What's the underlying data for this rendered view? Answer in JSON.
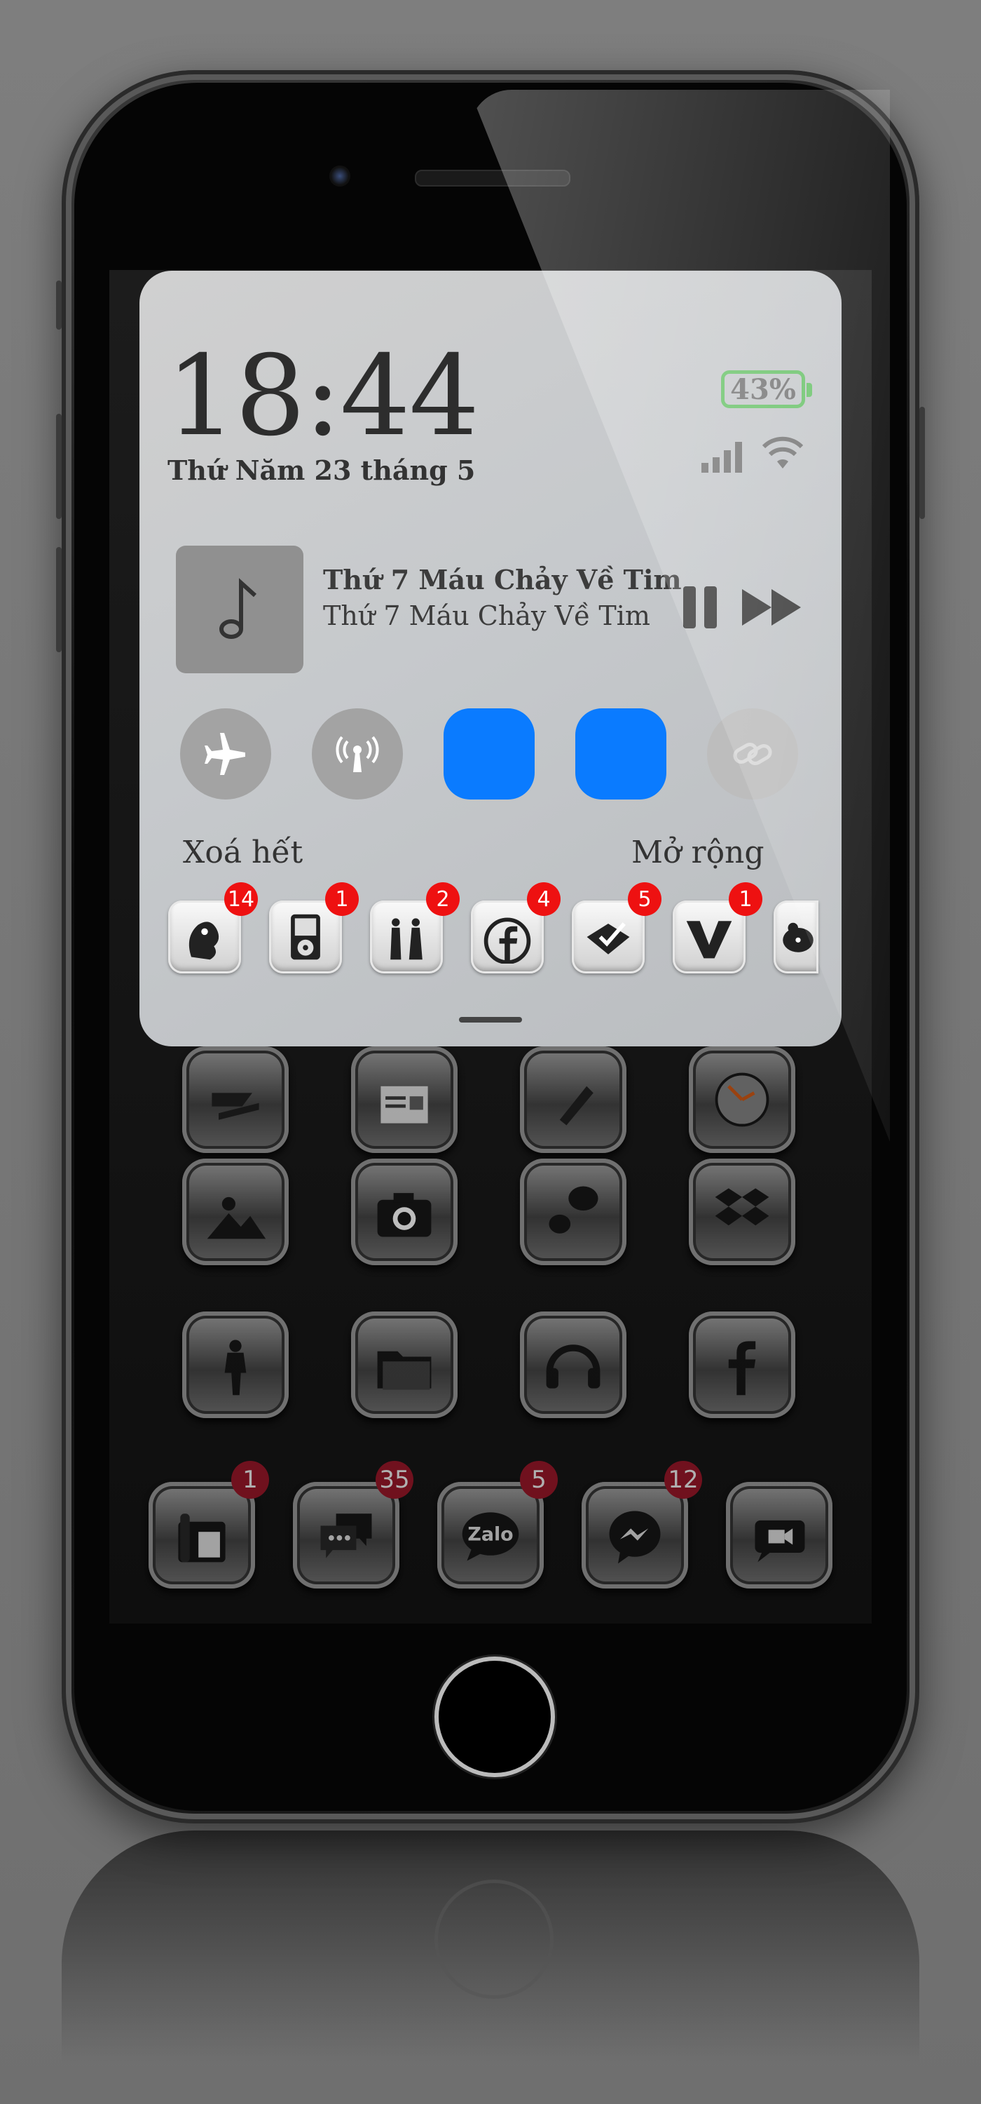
{
  "lock": {
    "time": "18:44",
    "date": "Thứ Năm 23 tháng 5",
    "battery": "43%"
  },
  "media": {
    "title": "Thứ 7 Máu Chảy Về Tim",
    "subtitle": "Thứ 7 Máu Chảy Về Tim",
    "album_icon": "music-note-icon",
    "controls": [
      "pause-icon",
      "fast-forward-icon"
    ]
  },
  "toggles": [
    {
      "name": "airplane-mode",
      "icon": "airplane-icon",
      "on": false
    },
    {
      "name": "cellular-data",
      "icon": "antenna-icon",
      "on": false
    },
    {
      "name": "toggle-3",
      "icon": "",
      "on": true
    },
    {
      "name": "toggle-4",
      "icon": "",
      "on": true
    },
    {
      "name": "screen-mirroring",
      "icon": "link-icon",
      "on": false
    }
  ],
  "notifications": {
    "clear_label": "Xoá hết",
    "expand_label": "Mở rộng",
    "apps": [
      {
        "icon": "game-icon",
        "badge": "14"
      },
      {
        "icon": "ipod-icon",
        "badge": "1"
      },
      {
        "icon": "music-band-icon",
        "badge": "2"
      },
      {
        "icon": "facebook-icon",
        "badge": "4"
      },
      {
        "icon": "tasks-icon",
        "badge": "5"
      },
      {
        "icon": "vietnamese-v-icon",
        "badge": "1"
      },
      {
        "icon": "bear-icon",
        "badge": ""
      }
    ]
  },
  "dock": {
    "apps": [
      {
        "icon": "phone-icon",
        "badge": "1"
      },
      {
        "icon": "messages-icon",
        "badge": "35"
      },
      {
        "icon": "zalo-icon",
        "badge": "5",
        "label": "Zalo"
      },
      {
        "icon": "messenger-icon",
        "badge": "12"
      },
      {
        "icon": "facetime-icon",
        "badge": ""
      }
    ]
  },
  "home_icons": [
    "papers-icon",
    "news-icon",
    "notes-icon",
    "clock-icon",
    "photos-icon",
    "camera-icon",
    "chat-bubble-icon",
    "dropbox-icon",
    "pubg-icon",
    "files-icon",
    "beats-icon",
    "facebook-icon"
  ],
  "colors": {
    "toggle_on": "#0a7bff",
    "badge_red": "#ee1111",
    "battery_green": "#6cc36c"
  }
}
